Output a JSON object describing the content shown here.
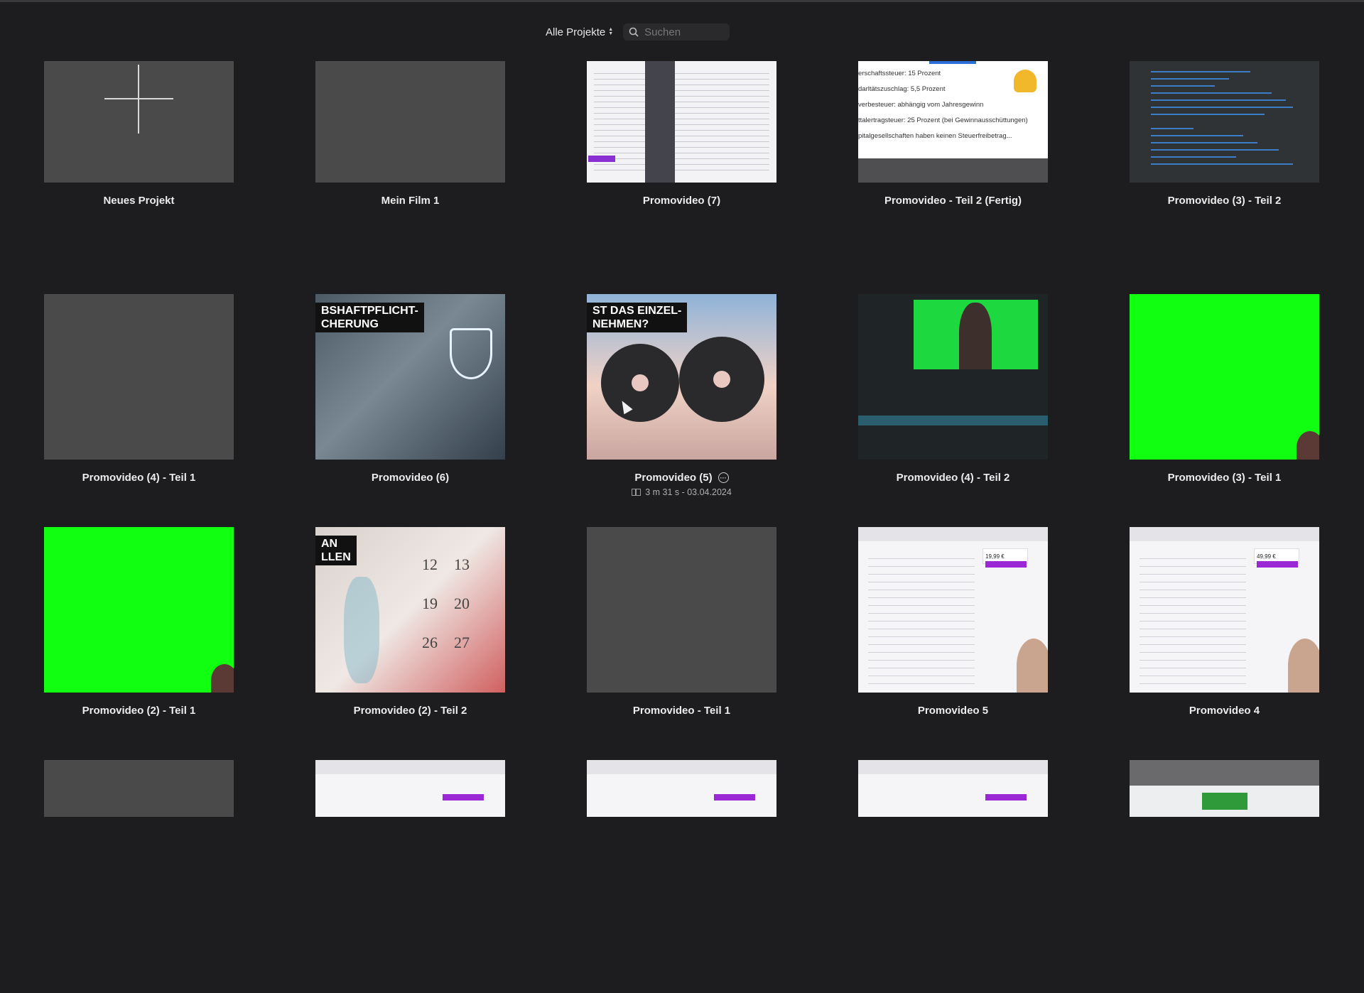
{
  "toolbar": {
    "filter_label": "Alle Projekte",
    "search_placeholder": "Suchen",
    "search_value": ""
  },
  "projects": [
    {
      "title": "Neues Projekt",
      "thumb": "new-plus"
    },
    {
      "title": "Mein Film 1",
      "thumb": "empty-gray"
    },
    {
      "title": "Promovideo (7)",
      "thumb": "document-screenshot"
    },
    {
      "title": "Promovideo - Teil 2 (Fertig)",
      "thumb": "tax-slide",
      "thumb_text": [
        "erschaftssteuer: 15 Prozent",
        "darltätszuschlag: 5,5 Prozent",
        "verbesteuer: abhängig vom Jahresgewinn",
        "ttalertragsteuer: 25 Prozent (bei Gewinnausschüttungen)",
        "pitalgesellschaften haben keinen Steuerfreibetrag..."
      ]
    },
    {
      "title": "Promovideo (3) - Teil 2",
      "thumb": "code-list"
    },
    {
      "title": "Promovideo (4) - Teil 1",
      "thumb": "empty-gray"
    },
    {
      "title": "Promovideo (6)",
      "thumb": "insurance-shield",
      "thumb_text": [
        "BSHAFTPFLICHT-",
        "CHERUNG"
      ]
    },
    {
      "title": "Promovideo (5)",
      "thumb": "gears",
      "selected": true,
      "meta": "3 m 31 s - 03.04.2024",
      "thumb_text": [
        "ST DAS EINZEL-",
        "NEHMEN?"
      ]
    },
    {
      "title": "Promovideo (4) - Teil 2",
      "thumb": "editor-screenshot"
    },
    {
      "title": "Promovideo (3) - Teil 1",
      "thumb": "green-screen"
    },
    {
      "title": "Promovideo (2) - Teil 1",
      "thumb": "green-screen"
    },
    {
      "title": "Promovideo (2) - Teil 2",
      "thumb": "calendar-hourglass",
      "thumb_text": [
        "AN",
        "LLEN"
      ]
    },
    {
      "title": "Promovideo - Teil 1",
      "thumb": "empty-gray"
    },
    {
      "title": "Promovideo 5",
      "thumb": "webpage-pricing",
      "price": "19,99 €"
    },
    {
      "title": "Promovideo 4",
      "thumb": "webpage-pricing",
      "price": "49,99 €"
    }
  ],
  "colors": {
    "background": "#1d1d1f",
    "thumb_placeholder": "#4a4a4a",
    "green_screen": "#11ff11"
  }
}
